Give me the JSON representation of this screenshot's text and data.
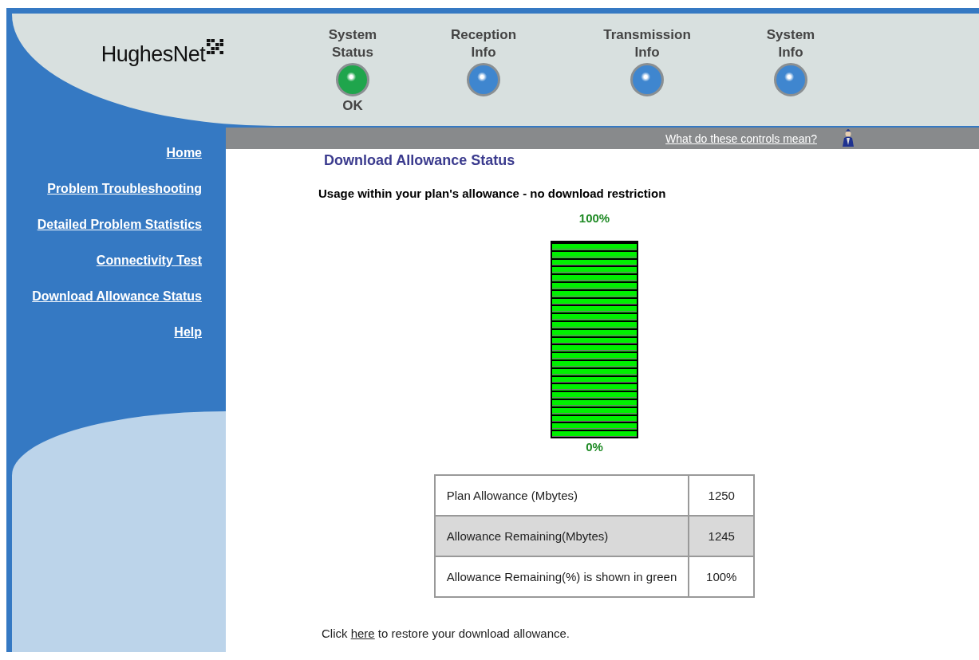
{
  "header": {
    "logo": "HughesNet",
    "indicators": [
      {
        "label": "System Status",
        "color": "#1fa54c",
        "status": "OK"
      },
      {
        "label": "Reception Info",
        "color": "#3f86cf"
      },
      {
        "label": "Transmission Info",
        "color": "#3f86cf"
      },
      {
        "label": "System Info",
        "color": "#3f86cf"
      }
    ]
  },
  "help_bar": {
    "link": "What do these controls mean?"
  },
  "sidebar": {
    "items": [
      {
        "label": "Home"
      },
      {
        "label": "Problem Troubleshooting"
      },
      {
        "label": "Detailed Problem Statistics"
      },
      {
        "label": "Connectivity Test"
      },
      {
        "label": "Download Allowance Status"
      },
      {
        "label": "Help"
      }
    ]
  },
  "content": {
    "title": "Download Allowance Status",
    "message": "Usage within your plan's allowance - no download restriction",
    "meter": {
      "top_label": "100%",
      "bottom_label": "0%",
      "level": 1.0
    },
    "table": {
      "rows": [
        {
          "label": "Plan Allowance (Mbytes)",
          "value": "1250"
        },
        {
          "label": "Allowance Remaining(Mbytes)",
          "value": "1245"
        },
        {
          "label": "Allowance Remaining(%) is shown in green",
          "value": "100%"
        }
      ]
    },
    "footer": {
      "before": "Click ",
      "link": "here",
      "after": " to restore your download allowance."
    }
  }
}
